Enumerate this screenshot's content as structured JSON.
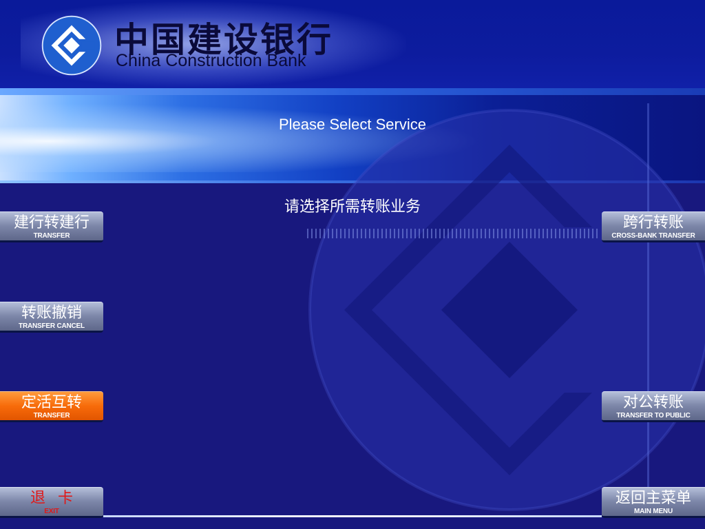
{
  "header": {
    "bank_name_cn": "中国建设银行",
    "bank_name_en": "China Construction Bank"
  },
  "screen": {
    "title_en": "Please Select Service",
    "title_cn": "请选择所需转账业务"
  },
  "left_buttons": [
    {
      "label_cn": "建行转建行",
      "label_en": "TRANSFER"
    },
    {
      "label_cn": "转账撤销",
      "label_en": "TRANSFER CANCEL"
    },
    {
      "label_cn": "定活互转",
      "label_en": "TRANSFER",
      "selected": true
    },
    {
      "label_cn": "退卡",
      "label_en": "EXIT"
    }
  ],
  "right_buttons": [
    {
      "label_cn": "跨行转账",
      "label_en": "CROSS-BANK TRANSFER"
    },
    {
      "label_cn": "对公转账",
      "label_en": "TRANSFER TO PUBLIC"
    },
    {
      "label_cn": "返回主菜单",
      "label_en": "MAIN MENU"
    }
  ],
  "colors": {
    "background": "#18187e",
    "button_default": "#7d87a9",
    "button_selected": "#f76b0a",
    "exit_text": "#e01818"
  },
  "icons": [
    "ccb-logo-icon",
    "ccb-emblem-watermark-icon"
  ]
}
